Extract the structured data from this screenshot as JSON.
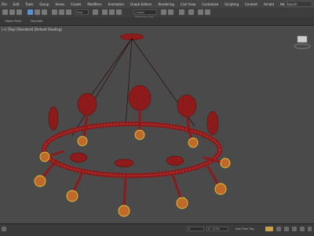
{
  "menu": {
    "items": [
      "File",
      "Edit",
      "Tools",
      "Group",
      "Views",
      "Create",
      "Modifiers",
      "Animation",
      "Graph Editors",
      "Rendering",
      "Civil View",
      "Customize",
      "Scripting",
      "Content",
      "Arnold",
      "Help"
    ],
    "search_placeholder": "Search"
  },
  "toolbar": {
    "view_field": "View",
    "named_selection": "Create Selection Set"
  },
  "ribbon": {
    "tabs": [
      "Object Paint",
      "Populate"
    ]
  },
  "viewport": {
    "label": "[+] [Top] [Standard] [Default Shading]",
    "background_color": "#4a4a4a",
    "model_color": "#8b1a1a"
  },
  "status": {
    "frame_field": "0",
    "coords_field": "X: -0.0m",
    "selected_text": "Add Time Tag",
    "autokey_label": "Auto Key"
  }
}
